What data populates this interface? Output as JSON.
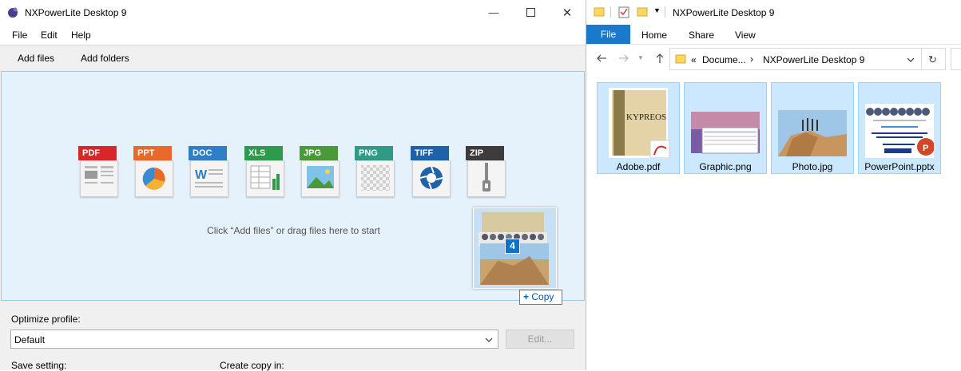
{
  "nx": {
    "title": "NXPowerLite Desktop 9",
    "menu": [
      "File",
      "Edit",
      "Help"
    ],
    "toolbar": {
      "add_files": "Add files",
      "add_folders": "Add folders"
    },
    "file_types": [
      {
        "label": "PDF",
        "color": "#d9262b"
      },
      {
        "label": "PPT",
        "color": "#e8692a"
      },
      {
        "label": "DOC",
        "color": "#2f7ec7"
      },
      {
        "label": "XLS",
        "color": "#2e9a4b"
      },
      {
        "label": "JPG",
        "color": "#4b9a3a"
      },
      {
        "label": "PNG",
        "color": "#2f9a86"
      },
      {
        "label": "TIFF",
        "color": "#1f62a8"
      },
      {
        "label": "ZIP",
        "color": "#3c3c3c"
      }
    ],
    "hint": "Click “Add files” or drag files here to start",
    "drag": {
      "count": "4",
      "copy_label": "Copy"
    },
    "optimize_profile_label": "Optimize profile:",
    "profile_value": "Default",
    "edit_button": "Edit...",
    "save_setting_label": "Save setting:",
    "create_copy_label": "Create copy in:"
  },
  "explorer": {
    "title": "NXPowerLite Desktop 9",
    "tabs": {
      "file": "File",
      "home": "Home",
      "share": "Share",
      "view": "View"
    },
    "breadcrumb": {
      "prefix": "«",
      "parent": "Docume...",
      "current": "NXPowerLite Desktop 9"
    },
    "files": [
      {
        "name": "Adobe.pdf"
      },
      {
        "name": "Graphic.png"
      },
      {
        "name": "Photo.jpg"
      },
      {
        "name": "PowerPoint.pptx"
      }
    ]
  },
  "colors": {
    "accent": "#1979ca",
    "drop_bg": "#e5f1fb",
    "selection": "#cce8ff"
  }
}
